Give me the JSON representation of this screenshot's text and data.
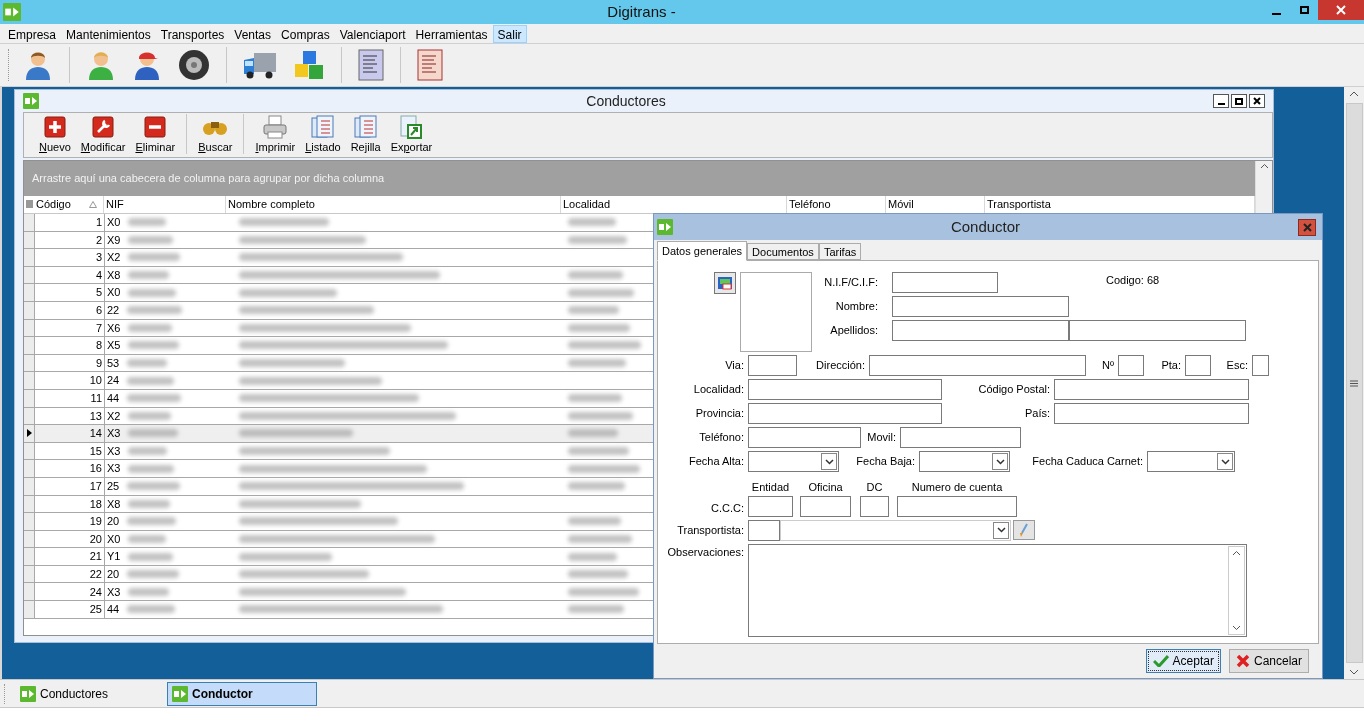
{
  "window": {
    "title": "Digitrans -"
  },
  "menu": [
    {
      "label": "Empresa",
      "selected": false
    },
    {
      "label": "Mantenimientos",
      "selected": false
    },
    {
      "label": "Transportes",
      "selected": false
    },
    {
      "label": "Ventas",
      "selected": false
    },
    {
      "label": "Compras",
      "selected": false
    },
    {
      "label": "Valenciaport",
      "selected": false
    },
    {
      "label": "Herramientas",
      "selected": false
    },
    {
      "label": "Salir",
      "selected": true
    }
  ],
  "conductores": {
    "title": "Conductores",
    "actions": [
      {
        "kind": "new",
        "access_key": "N",
        "label_rest": "uevo"
      },
      {
        "kind": "edit",
        "access_key": "M",
        "label_rest": "odificar"
      },
      {
        "kind": "delete",
        "access_key": "E",
        "label_rest": "liminar"
      },
      {
        "kind": "search",
        "access_key": "B",
        "label_rest": "uscar"
      },
      {
        "kind": "print",
        "access_key": "I",
        "label_rest": "mprimir"
      },
      {
        "kind": "list",
        "access_key": "L",
        "label_rest": "istado"
      },
      {
        "kind": "grid",
        "label_start": "Re",
        "access_key": "j",
        "label_rest": "illa"
      },
      {
        "kind": "export",
        "label_start": "Ex",
        "access_key": "p",
        "label_rest": "ortar"
      }
    ],
    "group_panel": "Arrastre aquí una cabecera de columna para agrupar por dicha columna",
    "columns": [
      {
        "label": "Código",
        "sorted": true
      },
      {
        "label": "NIF",
        "sorted": false
      },
      {
        "label": "Nombre completo",
        "sorted": false
      },
      {
        "label": "Localidad",
        "sorted": false
      },
      {
        "label": "Teléfono",
        "sorted": false
      },
      {
        "label": "Móvil",
        "sorted": false
      },
      {
        "label": "Transportista",
        "sorted": false
      }
    ],
    "rows": [
      {
        "codigo": "1",
        "nif": "X0",
        "selected": false
      },
      {
        "codigo": "2",
        "nif": "X9",
        "selected": false
      },
      {
        "codigo": "3",
        "nif": "X2",
        "selected": false
      },
      {
        "codigo": "4",
        "nif": "X8",
        "selected": false
      },
      {
        "codigo": "5",
        "nif": "X0",
        "selected": false
      },
      {
        "codigo": "6",
        "nif": "22",
        "selected": false
      },
      {
        "codigo": "7",
        "nif": "X6",
        "selected": false
      },
      {
        "codigo": "8",
        "nif": "X5",
        "selected": false
      },
      {
        "codigo": "9",
        "nif": "53",
        "selected": false
      },
      {
        "codigo": "10",
        "nif": "24",
        "selected": false
      },
      {
        "codigo": "11",
        "nif": "44",
        "selected": false
      },
      {
        "codigo": "13",
        "nif": "X2",
        "selected": false
      },
      {
        "codigo": "14",
        "nif": "X3",
        "selected": true
      },
      {
        "codigo": "15",
        "nif": "X3",
        "selected": false
      },
      {
        "codigo": "16",
        "nif": "X3",
        "selected": false
      },
      {
        "codigo": "17",
        "nif": "25",
        "selected": false
      },
      {
        "codigo": "18",
        "nif": "X8",
        "selected": false
      },
      {
        "codigo": "19",
        "nif": "20",
        "selected": false
      },
      {
        "codigo": "20",
        "nif": "X0",
        "selected": false
      },
      {
        "codigo": "21",
        "nif": "Y1",
        "selected": false
      },
      {
        "codigo": "22",
        "nif": "20",
        "selected": false
      },
      {
        "codigo": "24",
        "nif": "X3",
        "selected": false
      },
      {
        "codigo": "25",
        "nif": "44",
        "selected": false
      }
    ]
  },
  "dialog": {
    "title": "Conductor",
    "tabs": [
      {
        "label": "Datos generales",
        "selected": true
      },
      {
        "label": "Documentos",
        "selected": false
      },
      {
        "label": "Tarifas",
        "selected": false
      }
    ],
    "codigo": "Codigo: 68",
    "labels": {
      "nif": "N.I.F/C.I.F:",
      "nombre": "Nombre:",
      "apellidos": "Apellidos:",
      "via": "Via:",
      "direccion": "Dirección:",
      "numero": "Nº",
      "pta": "Pta:",
      "esc": "Esc:",
      "localidad": "Localidad:",
      "codigo_postal": "Código Postal:",
      "provincia": "Provincia:",
      "pais": "País:",
      "telefono": "Teléfono:",
      "movil": "Movil:",
      "fecha_alta": "Fecha Alta:",
      "fecha_baja": "Fecha Baja:",
      "fecha_caduca": "Fecha Caduca Carnet:",
      "ccc": "C.C.C:",
      "entidad": "Entidad",
      "oficina": "Oficina",
      "dc": "DC",
      "cuenta": "Numero de cuenta",
      "transportista": "Transportista:",
      "observaciones": "Observaciones:"
    },
    "buttons": [
      {
        "kind": "accept",
        "label": "Aceptar",
        "focused": true
      },
      {
        "kind": "cancel",
        "label": "Cancelar",
        "focused": false
      }
    ]
  },
  "taskbar": [
    {
      "label": "Conductores",
      "selected": false
    },
    {
      "label": "Conductor",
      "selected": true
    }
  ]
}
